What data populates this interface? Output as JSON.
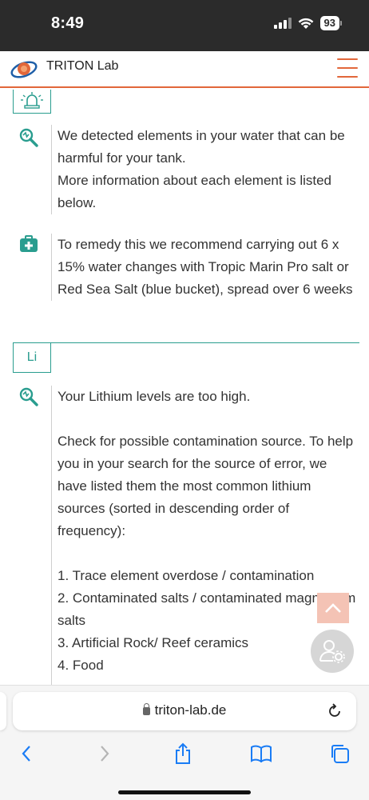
{
  "status_bar": {
    "time": "8:49",
    "battery": "93"
  },
  "header": {
    "brand": "TRITON Lab"
  },
  "sections": {
    "general": {
      "detected": [
        "We detected elements in your water that can be harmful for your tank.",
        "More information about each element is listed below."
      ],
      "remedy": "To remedy this we recommend carrying out 6 x 15% water changes with Tropic Marin Pro salt or Red Sea Salt (blue bucket), spread over 6 weeks"
    },
    "lithium": {
      "symbol": "Li",
      "headline": "Your Lithium levels are too high.",
      "advice": "Check for possible contamination source. To help you in your search for the source of error, we have listed them the most common lithium sources (sorted in descending order of frequency):",
      "sources": [
        "1. Trace element overdose / contamination",
        "2. Contaminated salts / contaminated magnesium salts",
        "3. Artificial Rock/ Reef ceramics",
        "4. Food"
      ]
    }
  },
  "browser": {
    "url": "triton-lab.de"
  },
  "colors": {
    "accent_orange": "#e2673a",
    "teal": "#2a9d8f"
  },
  "icons": {
    "alarm": "alarm-light-icon",
    "analysis": "magnifier-analysis-icon",
    "remedy": "first-aid-kit-icon"
  }
}
